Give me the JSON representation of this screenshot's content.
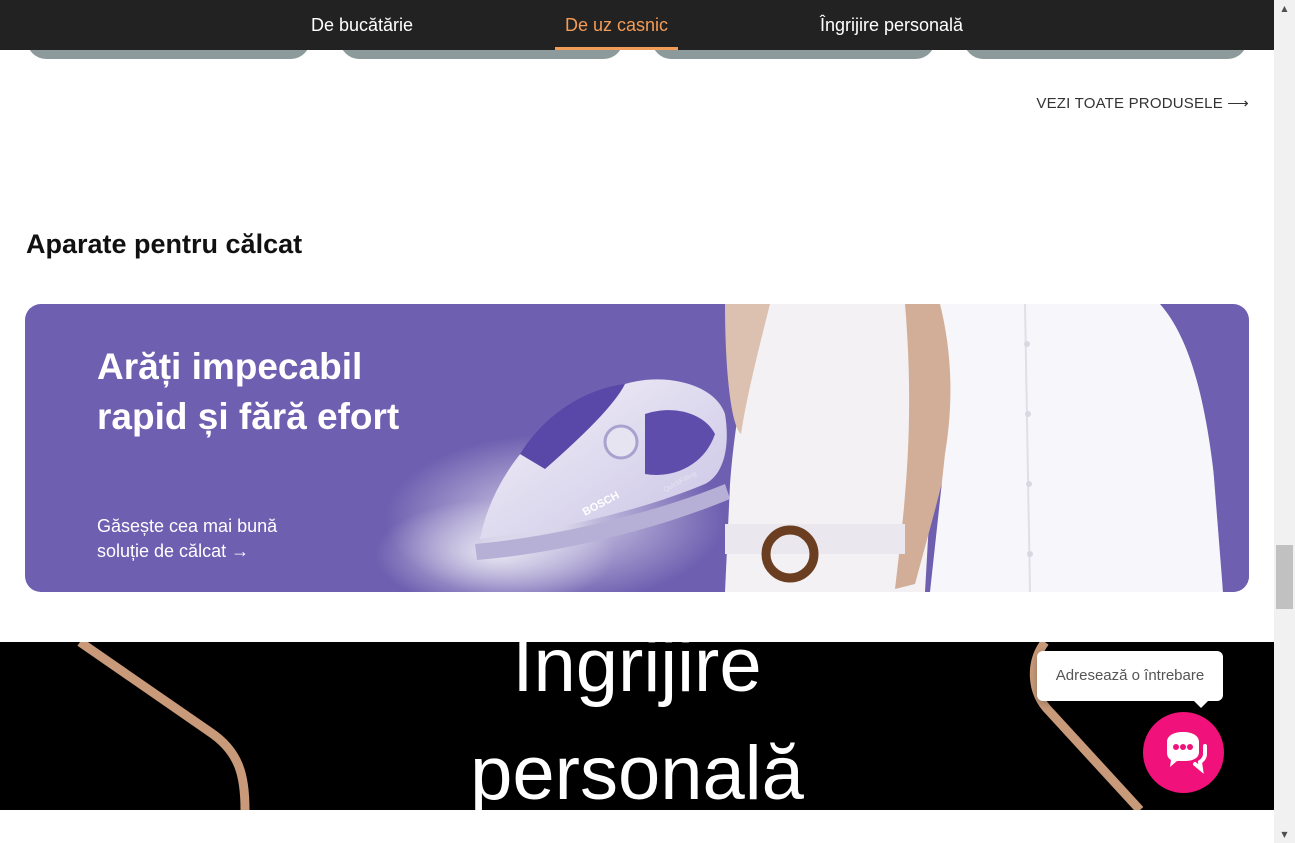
{
  "nav": {
    "tabs": [
      {
        "label": "De bucătărie",
        "active": false
      },
      {
        "label": "De uz casnic",
        "active": true
      },
      {
        "label": "Îngrijire personală",
        "active": false
      }
    ]
  },
  "see_all_label": "VEZI TOATE PRODUSELE ⟶",
  "section": {
    "title": "Aparate pentru călcat"
  },
  "banner": {
    "headline_line1": "Arăți impecabil",
    "headline_line2": "rapid și fără efort",
    "cta_line1": "Găsește cea mai bună",
    "cta_line2": "soluție de călcat →",
    "iron_brand": "BOSCH",
    "iron_model": "QuickFilling"
  },
  "dark_section": {
    "title_line1": "Îngrijire",
    "title_line2": "personală"
  },
  "chat": {
    "placeholder": "Adresează o întrebare",
    "button_icon": "chat-icon"
  },
  "colors": {
    "nav_bg": "#222222",
    "accent": "#f39c57",
    "banner_bg": "#6e5fb0",
    "chat_button": "#f0117a",
    "card_stub": "#8c9a9b"
  }
}
